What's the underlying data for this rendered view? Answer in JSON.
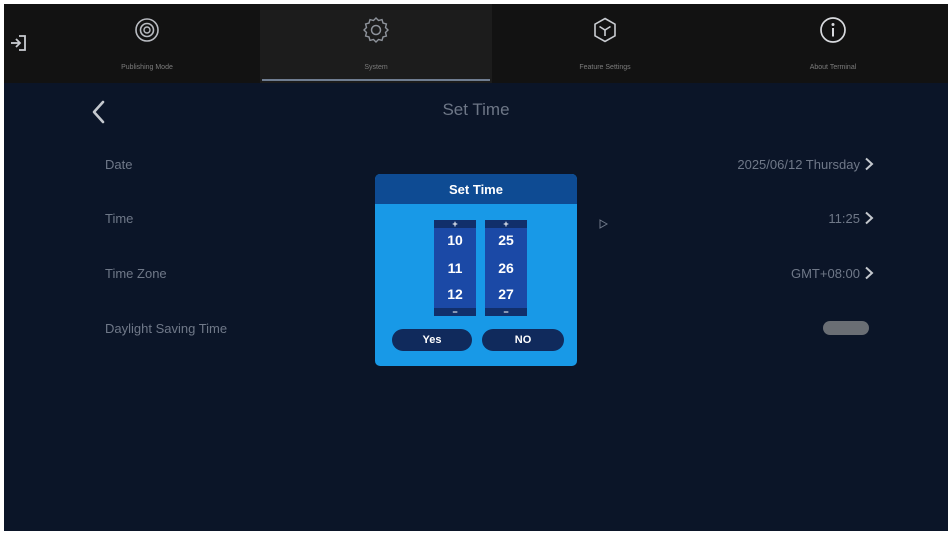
{
  "nav": {
    "tabs": [
      {
        "label": "Publishing Mode",
        "icon": "target-icon"
      },
      {
        "label": "System",
        "icon": "gear-icon"
      },
      {
        "label": "Feature Settings",
        "icon": "cube-icon"
      },
      {
        "label": "About Terminal",
        "icon": "info-icon"
      }
    ],
    "active_tab": 1
  },
  "page": {
    "title": "Set Time"
  },
  "settings": {
    "date": {
      "label": "Date",
      "value": "2025/06/12  Thursday"
    },
    "time": {
      "label": "Time",
      "value": "11:25"
    },
    "timezone": {
      "label": "Time Zone",
      "value": "GMT+08:00"
    },
    "dst": {
      "label": "Daylight Saving Time",
      "enabled": false
    }
  },
  "dialog": {
    "title": "Set Time",
    "hour": {
      "prev": "10",
      "current": "11",
      "next": "12",
      "plus": "+",
      "minus": "−"
    },
    "minute": {
      "prev": "25",
      "current": "26",
      "next": "27",
      "plus": "+",
      "minus": "−"
    },
    "yes_label": "Yes",
    "no_label": "NO"
  },
  "colors": {
    "background": "#0b1528",
    "topbar": "#121212",
    "dialog": "#1899e7",
    "dialog_header": "#0e4b93",
    "spinner": "#1b49a6",
    "button": "#102a5c"
  }
}
